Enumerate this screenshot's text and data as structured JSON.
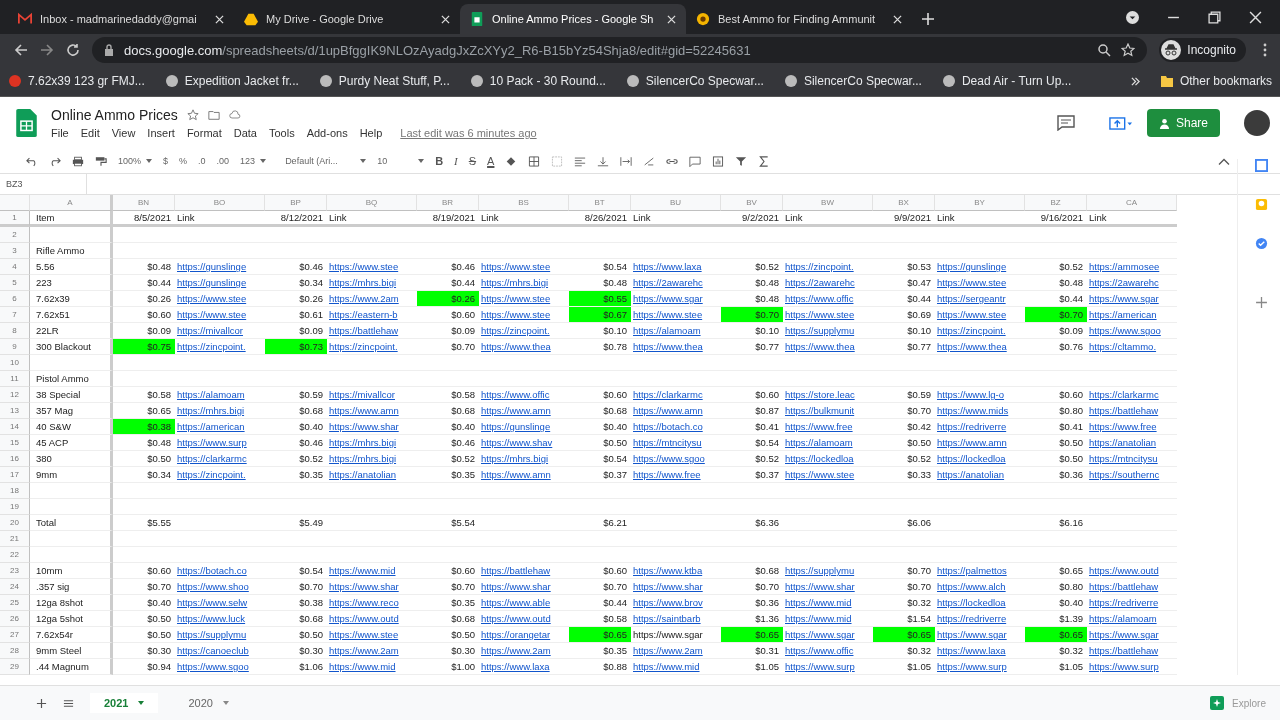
{
  "browser": {
    "tabs": [
      {
        "title": "Inbox - madmarinedaddy@gmai",
        "kind": "mail",
        "selected": false
      },
      {
        "title": "My Drive - Google Drive",
        "kind": "drive",
        "selected": false
      },
      {
        "title": "Online Ammo Prices - Google Sh",
        "kind": "sheets",
        "selected": true
      },
      {
        "title": "Best Ammo for Finding Ammunit",
        "kind": "site",
        "selected": false
      }
    ],
    "url_host": "docs.google.com",
    "url_path": "/spreadsheets/d/1upBfggIK9NLOzAyadgJxZcXYy2_R6-B15bYz54Shja8/edit#gid=52245631",
    "profile": "Incognito",
    "bookmarks": [
      "7.62x39 123 gr FMJ...",
      "Expedition Jacket fr...",
      "Purdy Neat Stuff, P...",
      "10 Pack - 30 Round...",
      "SilencerCo Specwar...",
      "SilencerCo Specwar...",
      "Dead Air - Turn Up..."
    ],
    "other_bookmarks": "Other bookmarks"
  },
  "doc": {
    "title": "Online Ammo Prices",
    "menu": [
      "File",
      "Edit",
      "View",
      "Insert",
      "Format",
      "Data",
      "Tools",
      "Add-ons",
      "Help"
    ],
    "last_edit": "Last edit was 6 minutes ago",
    "share": "Share"
  },
  "toolbar": {
    "zoom": "100%",
    "currency": "$",
    "percent": "%",
    "dec_less": ".0",
    "dec_more": ".00",
    "number_format": "123",
    "font": "Default (Ari...",
    "size": "10",
    "bold": "B",
    "italic": "I",
    "strike": "S",
    "text_color": "A"
  },
  "name_box": "BZ3",
  "sheet": {
    "columns": [
      "A",
      "BN",
      "BO",
      "BP",
      "BQ",
      "BR",
      "BS",
      "BT",
      "BU",
      "BV",
      "BW",
      "BX",
      "BY",
      "BZ",
      "CA"
    ],
    "header": {
      "n": "1",
      "label": "Item",
      "dates": [
        {
          "date": "8/5/2021",
          "link": "Link"
        },
        {
          "date": "8/12/2021",
          "link": "Link"
        },
        {
          "date": "8/19/2021",
          "link": "Link"
        },
        {
          "date": "8/26/2021",
          "link": "Link"
        },
        {
          "date": "9/2/2021",
          "link": "Link"
        },
        {
          "date": "9/9/2021",
          "link": "Link"
        },
        {
          "date": "9/16/2021",
          "link": "Link"
        }
      ]
    },
    "rows": [
      {
        "n": "2"
      },
      {
        "n": "3",
        "label": "Rifle Ammo"
      },
      {
        "n": "4",
        "label": "5.56",
        "cells": [
          {
            "price": "$0.48",
            "link": "https://gunslinge",
            "best": false
          },
          {
            "price": "$0.46",
            "link": "https://www.stee",
            "best": false
          },
          {
            "price": "$0.46",
            "link": "https://www.stee",
            "best": false
          },
          {
            "price": "$0.54",
            "link": "https://www.laxa",
            "best": false
          },
          {
            "price": "$0.52",
            "link": "https://zincpoint.",
            "best": false
          },
          {
            "price": "$0.53",
            "link": "https://gunslinge",
            "best": false
          },
          {
            "price": "$0.52",
            "link": "https://ammosee",
            "best": false
          }
        ]
      },
      {
        "n": "5",
        "label": "223",
        "cells": [
          {
            "price": "$0.44",
            "link": "https://gunslinge",
            "best": false
          },
          {
            "price": "$0.34",
            "link": "https://mhrs.bigi",
            "best": false
          },
          {
            "price": "$0.44",
            "link": "https://mhrs.bigi",
            "best": false
          },
          {
            "price": "$0.48",
            "link": "https://2awarehc",
            "best": false
          },
          {
            "price": "$0.48",
            "link": "https://2awarehc",
            "best": false
          },
          {
            "price": "$0.47",
            "link": "https://www.stee",
            "best": false
          },
          {
            "price": "$0.48",
            "link": "https://2awarehc",
            "best": false
          }
        ]
      },
      {
        "n": "6",
        "label": "7.62x39",
        "cells": [
          {
            "price": "$0.26",
            "link": "https://www.stee",
            "best": false
          },
          {
            "price": "$0.26",
            "link": "https://www.2am",
            "best": false
          },
          {
            "price": "$0.26",
            "link": "https://www.stee",
            "best": true
          },
          {
            "price": "$0.55",
            "link": "https://www.sgar",
            "best": true
          },
          {
            "price": "$0.48",
            "link": "https://www.offic",
            "best": false
          },
          {
            "price": "$0.44",
            "link": "https://sergeantr",
            "best": false
          },
          {
            "price": "$0.44",
            "link": "https://www.sgar",
            "best": false
          }
        ]
      },
      {
        "n": "7",
        "label": "7.62x51",
        "cells": [
          {
            "price": "$0.60",
            "link": "https://www.stee",
            "best": false
          },
          {
            "price": "$0.61",
            "link": "https://eastern-b",
            "best": false
          },
          {
            "price": "$0.60",
            "link": "https://www.stee",
            "best": false
          },
          {
            "price": "$0.67",
            "link": "https://www.stee",
            "best": true
          },
          {
            "price": "$0.70",
            "link": "https://www.stee",
            "best": true
          },
          {
            "price": "$0.69",
            "link": "https://www.stee",
            "best": false
          },
          {
            "price": "$0.70",
            "link": "https://american",
            "best": true
          }
        ]
      },
      {
        "n": "8",
        "label": "22LR",
        "cells": [
          {
            "price": "$0.09",
            "link": "https://mivallcor",
            "best": false
          },
          {
            "price": "$0.09",
            "link": "https://battlehaw",
            "best": false
          },
          {
            "price": "$0.09",
            "link": "https://zincpoint.",
            "best": false
          },
          {
            "price": "$0.10",
            "link": "https://alamoam",
            "best": false
          },
          {
            "price": "$0.10",
            "link": "https://supplymu",
            "best": false
          },
          {
            "price": "$0.10",
            "link": "https://zincpoint.",
            "best": false
          },
          {
            "price": "$0.09",
            "link": "https://www.sgoo",
            "best": false
          }
        ]
      },
      {
        "n": "9",
        "label": "300 Blackout",
        "cells": [
          {
            "price": "$0.75",
            "link": "https://zincpoint.",
            "best": true
          },
          {
            "price": "$0.73",
            "link": "https://zincpoint.",
            "best": true
          },
          {
            "price": "$0.70",
            "link": "https://www.thea",
            "best": false
          },
          {
            "price": "$0.78",
            "link": "https://www.thea",
            "best": false
          },
          {
            "price": "$0.77",
            "link": "https://www.thea",
            "best": false
          },
          {
            "price": "$0.77",
            "link": "https://www.thea",
            "best": false
          },
          {
            "price": "$0.76",
            "link": "https://cltammo.",
            "best": false
          }
        ]
      },
      {
        "n": "10"
      },
      {
        "n": "11",
        "label": "Pistol Ammo"
      },
      {
        "n": "12",
        "label": "38 Special",
        "cells": [
          {
            "price": "$0.58",
            "link": "https://alamoam",
            "best": false
          },
          {
            "price": "$0.59",
            "link": "https://mivallcor",
            "best": false
          },
          {
            "price": "$0.58",
            "link": "https://www.offic",
            "best": false
          },
          {
            "price": "$0.60",
            "link": "https://clarkarmc",
            "best": false
          },
          {
            "price": "$0.60",
            "link": "https://store.leac",
            "best": false
          },
          {
            "price": "$0.59",
            "link": "https://www.lg-o",
            "best": false
          },
          {
            "price": "$0.60",
            "link": "https://clarkarmc",
            "best": false
          }
        ]
      },
      {
        "n": "13",
        "label": "357 Mag",
        "cells": [
          {
            "price": "$0.65",
            "link": "https://mhrs.bigi",
            "best": false
          },
          {
            "price": "$0.68",
            "link": "https://www.amn",
            "best": false
          },
          {
            "price": "$0.68",
            "link": "https://www.amn",
            "best": false
          },
          {
            "price": "$0.68",
            "link": "https://www.amn",
            "best": false
          },
          {
            "price": "$0.87",
            "link": "https://bulkmunit",
            "best": false
          },
          {
            "price": "$0.70",
            "link": "https://www.mids",
            "best": false
          },
          {
            "price": "$0.80",
            "link": "https://battlehaw",
            "best": false
          }
        ]
      },
      {
        "n": "14",
        "label": "40 S&W",
        "cells": [
          {
            "price": "$0.38",
            "link": "https://american",
            "best": true
          },
          {
            "price": "$0.40",
            "link": "https://www.shar",
            "best": false
          },
          {
            "price": "$0.40",
            "link": "https://gunslinge",
            "best": false
          },
          {
            "price": "$0.40",
            "link": "https://botach.co",
            "best": false
          },
          {
            "price": "$0.41",
            "link": "https://www.free",
            "best": false
          },
          {
            "price": "$0.42",
            "link": "https://redriverre",
            "best": false
          },
          {
            "price": "$0.41",
            "link": "https://www.free",
            "best": false
          }
        ]
      },
      {
        "n": "15",
        "label": "45 ACP",
        "cells": [
          {
            "price": "$0.48",
            "link": "https://www.surp",
            "best": false
          },
          {
            "price": "$0.46",
            "link": "https://mhrs.bigi",
            "best": false
          },
          {
            "price": "$0.46",
            "link": "https://www.shav",
            "best": false
          },
          {
            "price": "$0.50",
            "link": "https://mtncitysu",
            "best": false
          },
          {
            "price": "$0.54",
            "link": "https://alamoam",
            "best": false
          },
          {
            "price": "$0.50",
            "link": "https://www.amn",
            "best": false
          },
          {
            "price": "$0.50",
            "link": "https://anatolian",
            "best": false
          }
        ]
      },
      {
        "n": "16",
        "label": "380",
        "cells": [
          {
            "price": "$0.50",
            "link": "https://clarkarmc",
            "best": false
          },
          {
            "price": "$0.52",
            "link": "https://mhrs.bigi",
            "best": false
          },
          {
            "price": "$0.52",
            "link": "https://mhrs.bigi",
            "best": false
          },
          {
            "price": "$0.54",
            "link": "https://www.sgoo",
            "best": false
          },
          {
            "price": "$0.52",
            "link": "https://lockedloa",
            "best": false
          },
          {
            "price": "$0.52",
            "link": "https://lockedloa",
            "best": false
          },
          {
            "price": "$0.50",
            "link": "https://mtncitysu",
            "best": false
          }
        ]
      },
      {
        "n": "17",
        "label": "9mm",
        "cells": [
          {
            "price": "$0.34",
            "link": "https://zincpoint.",
            "best": false
          },
          {
            "price": "$0.35",
            "link": "https://anatolian",
            "best": false
          },
          {
            "price": "$0.35",
            "link": "https://www.amn",
            "best": false
          },
          {
            "price": "$0.37",
            "link": "https://www.free",
            "best": false
          },
          {
            "price": "$0.37",
            "link": "https://www.stee",
            "best": false
          },
          {
            "price": "$0.33",
            "link": "https://anatolian",
            "best": false
          },
          {
            "price": "$0.36",
            "link": "https://southernc",
            "best": false
          }
        ]
      },
      {
        "n": "18"
      },
      {
        "n": "19"
      },
      {
        "n": "20",
        "label": "Total",
        "cells": [
          {
            "price": "$5.55",
            "best": false
          },
          {
            "price": "$5.49",
            "best": false
          },
          {
            "price": "$5.54",
            "best": false
          },
          {
            "price": "$6.21",
            "best": false
          },
          {
            "price": "$6.36",
            "best": false
          },
          {
            "price": "$6.06",
            "best": false
          },
          {
            "price": "$6.16",
            "best": false
          }
        ]
      },
      {
        "n": "21"
      },
      {
        "n": "22"
      },
      {
        "n": "23",
        "label": "10mm",
        "cells": [
          {
            "price": "$0.60",
            "link": "https://botach.co",
            "best": false
          },
          {
            "price": "$0.54",
            "link": "https://www.mid",
            "best": false
          },
          {
            "price": "$0.60",
            "link": "https://battlehaw",
            "best": false
          },
          {
            "price": "$0.60",
            "link": "https://www.ktba",
            "best": false
          },
          {
            "price": "$0.68",
            "link": "https://supplymu",
            "best": false
          },
          {
            "price": "$0.70",
            "link": "https://palmettos",
            "best": false
          },
          {
            "price": "$0.65",
            "link": "https://www.outd",
            "best": false
          }
        ]
      },
      {
        "n": "24",
        "label": ".357 sig",
        "cells": [
          {
            "price": "$0.70",
            "link": "https://www.shoo",
            "best": false
          },
          {
            "price": "$0.70",
            "link": "https://www.shar",
            "best": false
          },
          {
            "price": "$0.70",
            "link": "https://www.shar",
            "best": false
          },
          {
            "price": "$0.70",
            "link": "https://www.shar",
            "best": false
          },
          {
            "price": "$0.70",
            "link": "https://www.shar",
            "best": false
          },
          {
            "price": "$0.70",
            "link": "https://www.alch",
            "best": false
          },
          {
            "price": "$0.80",
            "link": "https://battlehaw",
            "best": false
          }
        ]
      },
      {
        "n": "25",
        "label": "12ga 8shot",
        "cells": [
          {
            "price": "$0.40",
            "link": "https://www.selw",
            "best": false
          },
          {
            "price": "$0.38",
            "link": "https://www.reco",
            "best": false
          },
          {
            "price": "$0.35",
            "link": "https://www.able",
            "best": false
          },
          {
            "price": "$0.44",
            "link": "https://www.brov",
            "best": false
          },
          {
            "price": "$0.36",
            "link": "https://www.mid",
            "best": false
          },
          {
            "price": "$0.32",
            "link": "https://lockedloa",
            "best": false
          },
          {
            "price": "$0.40",
            "link": "https://redriverre",
            "best": false
          }
        ]
      },
      {
        "n": "26",
        "label": "12ga 5shot",
        "cells": [
          {
            "price": "$0.50",
            "link": "https://www.luck",
            "best": false
          },
          {
            "price": "$0.68",
            "link": "https://www.outd",
            "best": false
          },
          {
            "price": "$0.68",
            "link": "https://www.outd",
            "best": false
          },
          {
            "price": "$0.58",
            "link": "https://saintbarb",
            "best": false
          },
          {
            "price": "$1.36",
            "link": "https://www.mid",
            "best": false
          },
          {
            "price": "$1.54",
            "link": "https://redriverre",
            "best": false
          },
          {
            "price": "$1.39",
            "link": "https://alamoam",
            "best": false
          }
        ]
      },
      {
        "n": "27",
        "label": "7.62x54r",
        "cells": [
          {
            "price": "$0.50",
            "link": "https://supplymu",
            "best": false
          },
          {
            "price": "$0.50",
            "link": "https://www.stee",
            "best": false
          },
          {
            "price": "$0.50",
            "link": "https://orangetar",
            "best": false
          },
          {
            "price": "$0.65",
            "link": "https://www.sgar",
            "best": true,
            "hyperlink": false
          },
          {
            "price": "$0.65",
            "link": "https://www.sgar",
            "best": true
          },
          {
            "price": "$0.65",
            "link": "https://www.sgar",
            "best": true
          },
          {
            "price": "$0.65",
            "link": "https://www.sgar",
            "best": true
          }
        ]
      },
      {
        "n": "28",
        "label": "9mm Steel",
        "cells": [
          {
            "price": "$0.30",
            "link": "https://canoeclub",
            "best": false
          },
          {
            "price": "$0.30",
            "link": "https://www.2am",
            "best": false
          },
          {
            "price": "$0.30",
            "link": "https://www.2am",
            "best": false
          },
          {
            "price": "$0.35",
            "link": "https://www.2am",
            "best": false
          },
          {
            "price": "$0.31",
            "link": "https://www.offic",
            "best": false
          },
          {
            "price": "$0.32",
            "link": "https://www.laxa",
            "best": false
          },
          {
            "price": "$0.32",
            "link": "https://battlehaw",
            "best": false
          }
        ]
      },
      {
        "n": "29",
        "label": ".44 Magnum",
        "cells": [
          {
            "price": "$0.94",
            "link": "https://www.sgoo",
            "best": false
          },
          {
            "price": "$1.06",
            "link": "https://www.mid",
            "best": false
          },
          {
            "price": "$1.00",
            "link": "https://www.laxa",
            "best": false
          },
          {
            "price": "$0.88",
            "link": "https://www.mid",
            "best": false
          },
          {
            "price": "$1.05",
            "link": "https://www.surp",
            "best": false
          },
          {
            "price": "$1.05",
            "link": "https://www.surp",
            "best": false
          },
          {
            "price": "$1.05",
            "link": "https://www.surp",
            "best": false
          }
        ]
      }
    ]
  },
  "sheet_tabs": [
    {
      "label": "2021",
      "selected": true
    },
    {
      "label": "2020",
      "selected": false
    }
  ],
  "explore": "Explore"
}
